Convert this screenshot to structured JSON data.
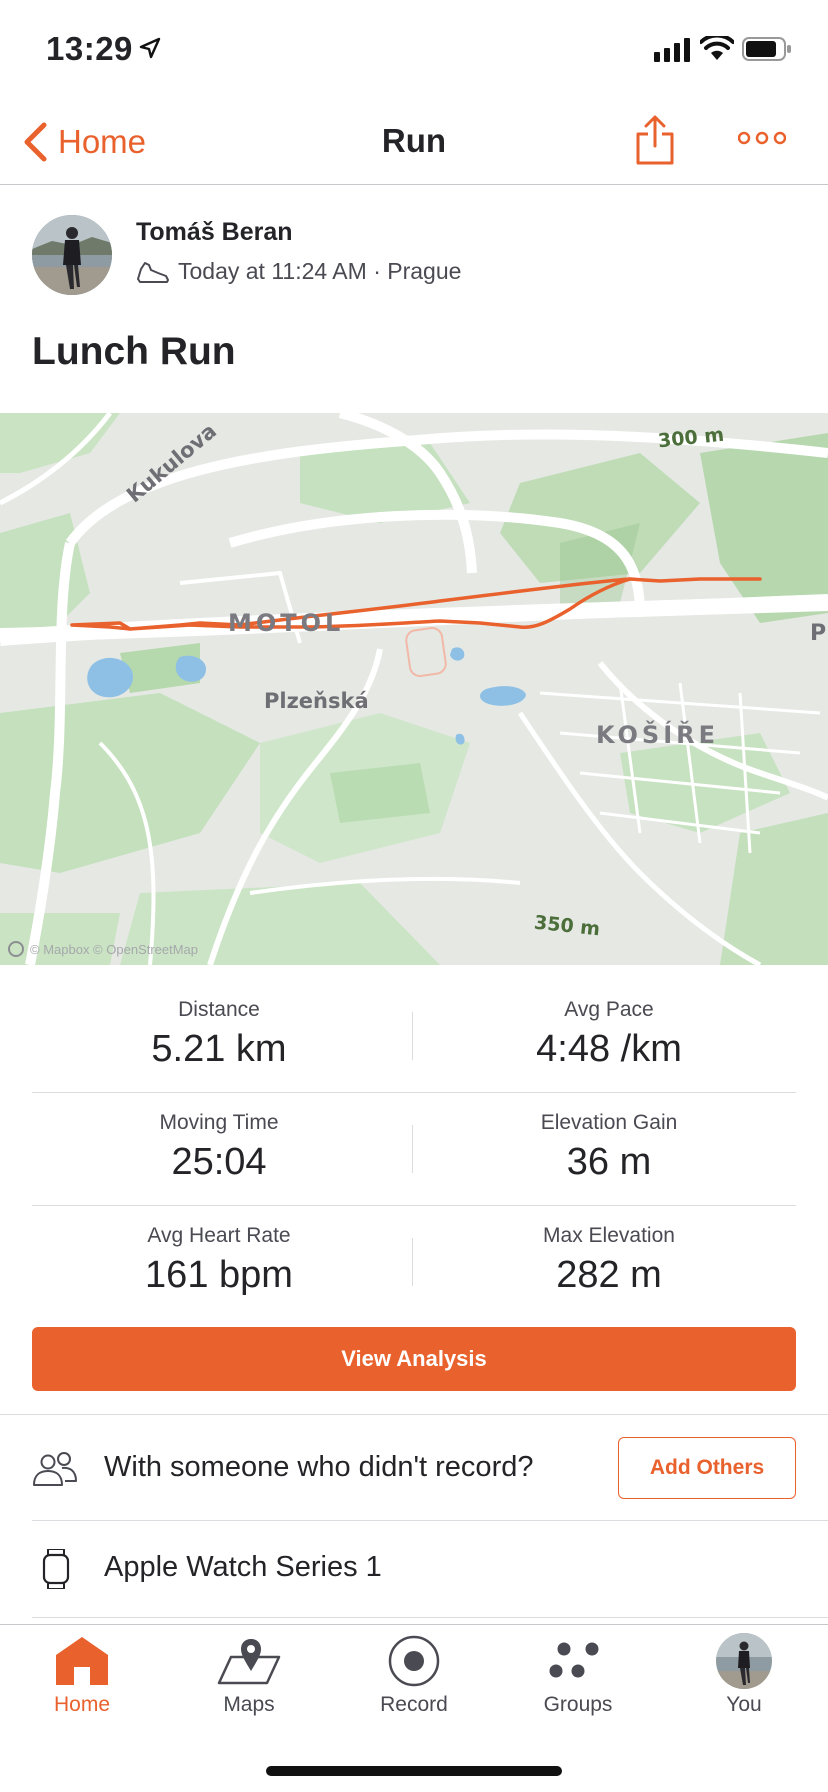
{
  "status_bar": {
    "time": "13:29"
  },
  "nav": {
    "back_label": "Home",
    "title": "Run"
  },
  "athlete": {
    "name": "Tomáš Beran",
    "meta": "Today at 11:24 AM · Prague"
  },
  "activity": {
    "title": "Lunch Run"
  },
  "map": {
    "labels": {
      "motol": "MOTOL",
      "kosire": "KOŠÍŘE",
      "kukulova": "Kukulova",
      "plzenska": "Plzeňská",
      "elev_300": "300 m",
      "elev_350": "350 m",
      "edge": "P"
    },
    "attribution": "© Mapbox © OpenStreetMap",
    "route_color": "#e9612c"
  },
  "stats": [
    {
      "left": {
        "label": "Distance",
        "value": "5.21 km"
      },
      "right": {
        "label": "Avg Pace",
        "value": "4:48 /km"
      }
    },
    {
      "left": {
        "label": "Moving Time",
        "value": "25:04"
      },
      "right": {
        "label": "Elevation Gain",
        "value": "36 m"
      }
    },
    {
      "left": {
        "label": "Avg Heart Rate",
        "value": "161 bpm"
      },
      "right": {
        "label": "Max Elevation",
        "value": "282 m"
      }
    }
  ],
  "actions": {
    "view_analysis": "View Analysis"
  },
  "others": {
    "text": "With someone who didn't record?",
    "button": "Add Others"
  },
  "device": {
    "name": "Apple Watch Series 1"
  },
  "tabs": [
    {
      "label": "Home",
      "icon": "home-icon",
      "active": true
    },
    {
      "label": "Maps",
      "icon": "maps-icon"
    },
    {
      "label": "Record",
      "icon": "record-icon"
    },
    {
      "label": "Groups",
      "icon": "groups-icon"
    },
    {
      "label": "You",
      "icon": "profile-avatar"
    }
  ],
  "colors": {
    "accent": "#e9612c",
    "text": "#242428",
    "map_green": "#b9dcb2"
  }
}
